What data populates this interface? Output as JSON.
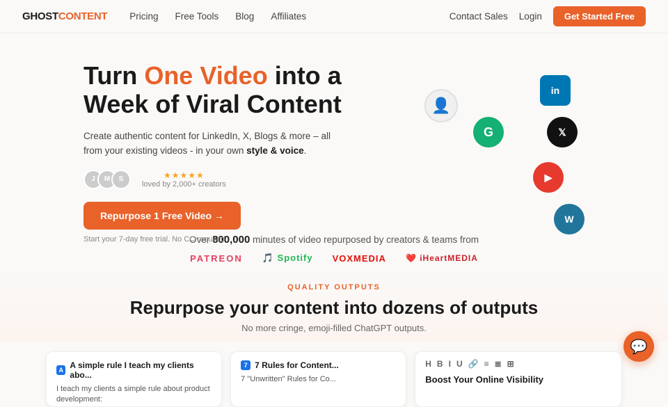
{
  "nav": {
    "logo_ghost": "GHOST",
    "logo_content": "CONTENT",
    "links": [
      "Pricing",
      "Free Tools",
      "Blog",
      "Affiliates"
    ],
    "right_links": [
      "Contact Sales",
      "Login"
    ],
    "cta_label": "Get Started Free"
  },
  "hero": {
    "title_start": "Turn ",
    "title_highlight": "One Video",
    "title_end": " into a Week of Viral Content",
    "subtitle": "Create authentic content for LinkedIn, X, Blogs & more – all from your existing videos - in your own ",
    "subtitle_bold": "style & voice",
    "subtitle_end": ".",
    "social_proof_label": "loved by 2,000+ creators",
    "cta_label": "Repurpose 1 Free Video →",
    "free_trial": "Start your 7-day free trial. No CC required"
  },
  "stats": {
    "minutes_label": "Over ",
    "minutes_bold": "800,000",
    "minutes_end": " minutes of video repurposed by creators & teams from"
  },
  "brands": [
    {
      "name": "PATREON",
      "class": "brand-patreon"
    },
    {
      "name": "Spotify",
      "class": "brand-spotify"
    },
    {
      "name": "VOXMEDIA",
      "class": "brand-vox"
    },
    {
      "name": "iHeartMEDIA",
      "class": "brand-iheartmedia"
    }
  ],
  "quality": {
    "label": "QUALITY OUTPUTS",
    "title": "Repurpose your content into dozens of outputs",
    "subtitle": "No more cringe, emoji-filled ChatGPT outputs."
  },
  "cards": [
    {
      "icon": "A",
      "title": "A simple rule I teach my clients abo...",
      "content": "I teach my clients a simple rule about product development:"
    },
    {
      "icon": "7",
      "title": "7 Rules for Content...",
      "content": "7 \"Unwritten\" Rules for Co..."
    }
  ],
  "editor": {
    "title": "Boost Your Online Visibility",
    "toolbar": [
      "H",
      "B",
      "I",
      "U",
      "🔗",
      "≡",
      "≣",
      "⊞"
    ]
  },
  "icons": {
    "linkedin": "in",
    "twitter": "𝕏",
    "grammarly": "G",
    "youtube": "▶",
    "wordpress": "W",
    "chat": "💬"
  }
}
